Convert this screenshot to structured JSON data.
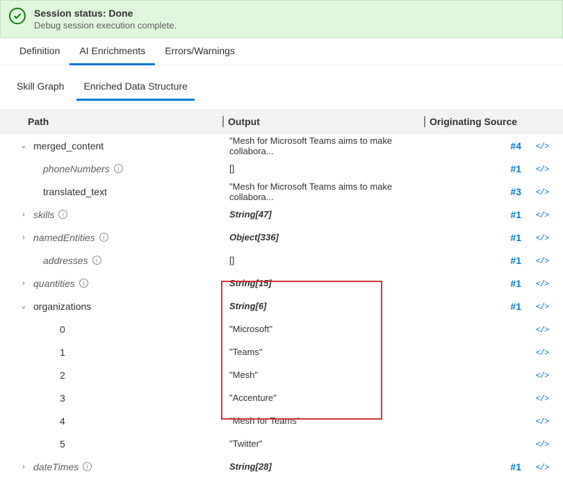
{
  "status": {
    "title": "Session status: Done",
    "subtitle": "Debug session execution complete."
  },
  "tabs": {
    "definition": "Definition",
    "enrichments": "AI Enrichments",
    "errors": "Errors/Warnings"
  },
  "subtabs": {
    "skillgraph": "Skill Graph",
    "enriched": "Enriched Data Structure"
  },
  "columns": {
    "path": "Path",
    "output": "Output",
    "source": "Originating Source"
  },
  "code_icon": "</>",
  "chart_data": {
    "type": "table",
    "columns": [
      "Path",
      "Output",
      "Originating Source"
    ],
    "rows": [
      {
        "path": "merged_content",
        "output": "\"Mesh for Microsoft Teams aims to make collabora...",
        "source": "#4"
      },
      {
        "path": "phoneNumbers",
        "output": "[]",
        "source": "#1"
      },
      {
        "path": "translated_text",
        "output": "\"Mesh for Microsoft Teams aims to make collabora...",
        "source": "#3"
      },
      {
        "path": "skills",
        "output": "String[47]",
        "source": "#1"
      },
      {
        "path": "namedEntities",
        "output": "Object[336]",
        "source": "#1"
      },
      {
        "path": "addresses",
        "output": "[]",
        "source": "#1"
      },
      {
        "path": "quantities",
        "output": "String[15]",
        "source": "#1"
      },
      {
        "path": "organizations",
        "output": "String[6]",
        "source": "#1"
      },
      {
        "path": "organizations.0",
        "output": "\"Microsoft\"",
        "source": ""
      },
      {
        "path": "organizations.1",
        "output": "\"Teams\"",
        "source": ""
      },
      {
        "path": "organizations.2",
        "output": "\"Mesh\"",
        "source": ""
      },
      {
        "path": "organizations.3",
        "output": "\"Accenture\"",
        "source": ""
      },
      {
        "path": "organizations.4",
        "output": "\"Mesh for Teams\"",
        "source": ""
      },
      {
        "path": "organizations.5",
        "output": "\"Twitter\"",
        "source": ""
      },
      {
        "path": "dateTimes",
        "output": "String[28]",
        "source": "#1"
      }
    ]
  },
  "rows": {
    "merged_content": {
      "label": "merged_content",
      "output": "\"Mesh for Microsoft Teams aims to make collabora...",
      "src": "#4"
    },
    "phoneNumbers": {
      "label": "phoneNumbers",
      "output": "[]",
      "src": "#1"
    },
    "translated_text": {
      "label": "translated_text",
      "output": "\"Mesh for Microsoft Teams aims to make collabora...",
      "src": "#3"
    },
    "skills": {
      "label": "skills",
      "output": "String[47]",
      "src": "#1"
    },
    "namedEntities": {
      "label": "namedEntities",
      "output": "Object[336]",
      "src": "#1"
    },
    "addresses": {
      "label": "addresses",
      "output": "[]",
      "src": "#1"
    },
    "quantities": {
      "label": "quantities",
      "output": "String[15]",
      "src": "#1"
    },
    "organizations": {
      "label": "organizations",
      "output": "String[6]",
      "src": "#1"
    },
    "org0": {
      "label": "0",
      "output": "\"Microsoft\""
    },
    "org1": {
      "label": "1",
      "output": "\"Teams\""
    },
    "org2": {
      "label": "2",
      "output": "\"Mesh\""
    },
    "org3": {
      "label": "3",
      "output": "\"Accenture\""
    },
    "org4": {
      "label": "4",
      "output": "\"Mesh for Teams\""
    },
    "org5": {
      "label": "5",
      "output": "\"Twitter\""
    },
    "dateTimes": {
      "label": "dateTimes",
      "output": "String[28]",
      "src": "#1"
    }
  }
}
